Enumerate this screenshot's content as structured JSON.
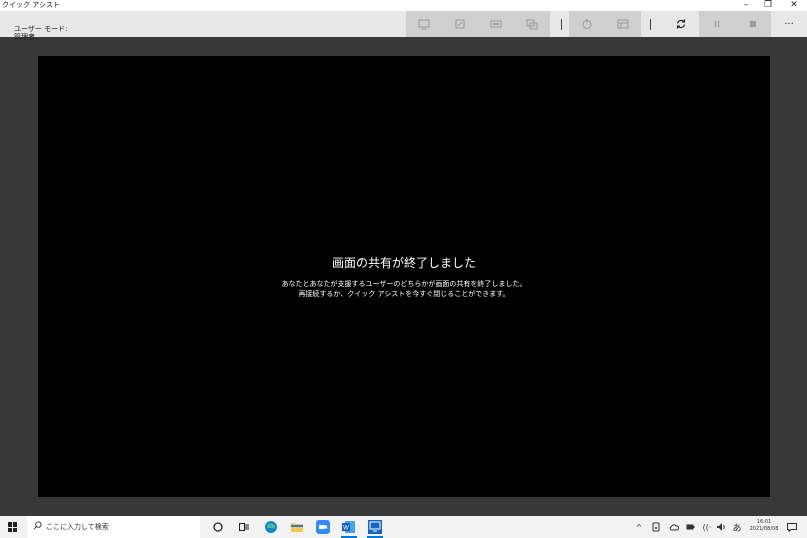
{
  "window": {
    "title": "クイック アシスト",
    "controls": {
      "minimize": "–",
      "maximize": "❐",
      "close": "✕"
    }
  },
  "toolbar": {
    "user_mode_label": "ユーザー モード:",
    "user_mode_value": "管理者",
    "more_label": "···"
  },
  "viewer": {
    "title": "画面の共有が終了しました",
    "line1": "あなたとあなたが支援するユーザーのどちらかが画面の共有を終了しました。",
    "line2": "再接続するか、クイック アシストを今すぐ閉じることができます。"
  },
  "taskbar": {
    "search_placeholder": "ここに入力して検索",
    "ime_label": "あ",
    "time": "16:01",
    "date": "2021/08/08"
  },
  "colors": {
    "accent": "#0078d7",
    "viewer_bg": "#000000",
    "frame_bg": "#383838"
  }
}
